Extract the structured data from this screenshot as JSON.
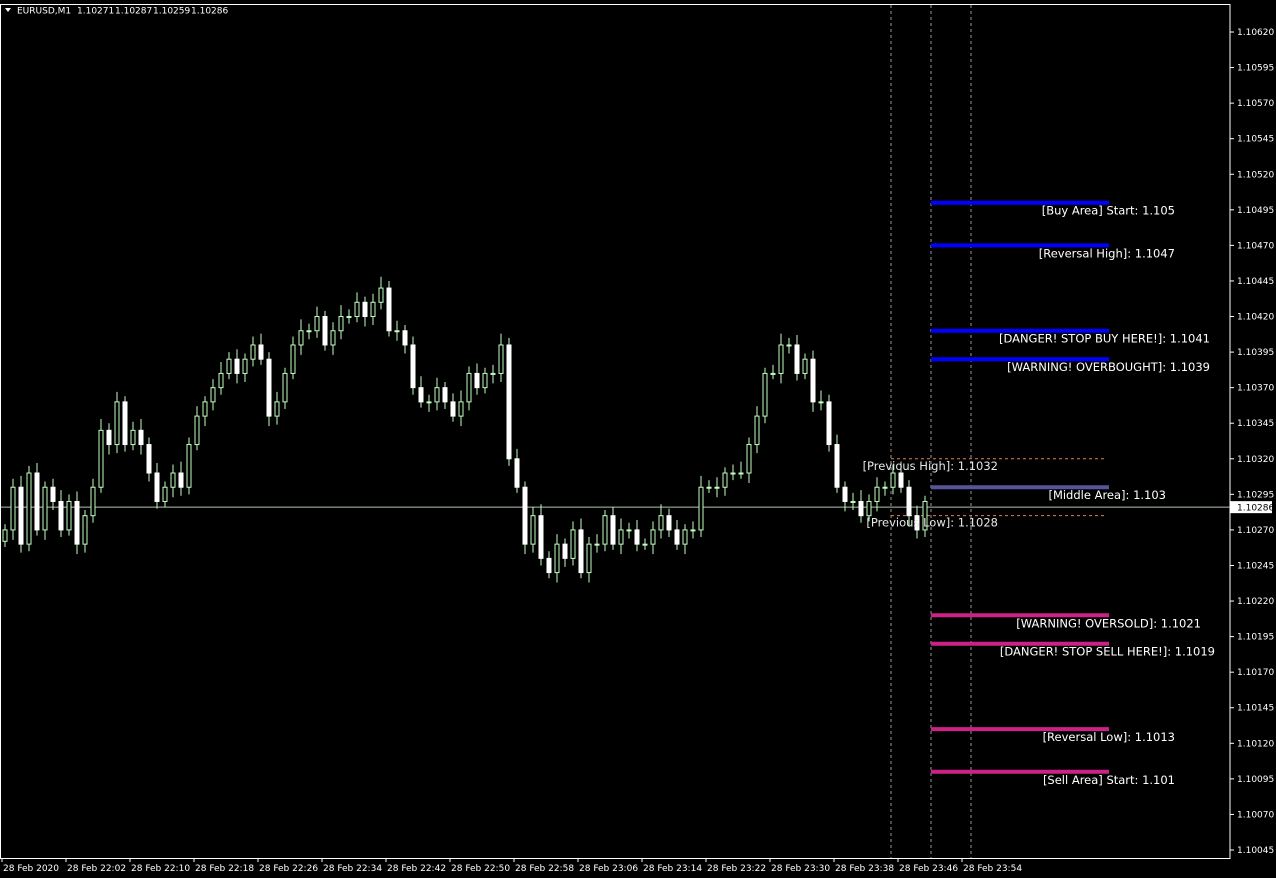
{
  "header": {
    "symbol_label": "EURUSD,M1",
    "open": "1.10271",
    "high": "1.10287",
    "low": "1.10259",
    "close": "1.10286"
  },
  "colors": {
    "background": "#000000",
    "frame": "#ffffff",
    "bull_body": "#000000",
    "bull_outline": "#bfffbf",
    "bear_body": "#ffffff",
    "wick": "#bfffbf",
    "buy_levels": "#0000ff",
    "sell_levels": "#cc2288",
    "middle_area": "#55559a",
    "bid_line": "#b0c4b0",
    "session_lines": "#ffffff",
    "prev_range": "#e08050"
  },
  "chart_data": {
    "type": "candlestick",
    "instrument": "EURUSD",
    "timeframe": "M1",
    "y_range": [
      1.1004,
      1.1063
    ],
    "y_ticks": [
      "1.10620",
      "1.10595",
      "1.10570",
      "1.10545",
      "1.10520",
      "1.10495",
      "1.10470",
      "1.10445",
      "1.10420",
      "1.10395",
      "1.10370",
      "1.10345",
      "1.10320",
      "1.10295",
      "1.10270",
      "1.10245",
      "1.10220",
      "1.10195",
      "1.10170",
      "1.10145",
      "1.10120",
      "1.10095",
      "1.10070",
      "1.10045"
    ],
    "x_ticks": [
      "28 Feb 2020",
      "28 Feb 22:02",
      "28 Feb 22:10",
      "28 Feb 22:18",
      "28 Feb 22:26",
      "28 Feb 22:34",
      "28 Feb 22:42",
      "28 Feb 22:50",
      "28 Feb 22:58",
      "28 Feb 23:06",
      "28 Feb 23:14",
      "28 Feb 23:22",
      "28 Feb 23:30",
      "28 Feb 23:38",
      "28 Feb 23:46",
      "28 Feb 23:54"
    ],
    "current_price": "1.10286",
    "closes": [
      1.1027,
      1.103,
      1.1026,
      1.1031,
      1.1027,
      1.103,
      1.1029,
      1.1027,
      1.1029,
      1.1026,
      1.1028,
      1.103,
      1.1034,
      1.1033,
      1.1036,
      1.1033,
      1.1034,
      1.1033,
      1.1031,
      1.1029,
      1.103,
      1.1031,
      1.103,
      1.1033,
      1.1035,
      1.1036,
      1.1037,
      1.1038,
      1.1039,
      1.1038,
      1.1039,
      1.104,
      1.1039,
      1.1035,
      1.1036,
      1.1038,
      1.104,
      1.1041,
      1.1041,
      1.1042,
      1.104,
      1.1041,
      1.1042,
      1.1042,
      1.1043,
      1.1042,
      1.1043,
      1.1044,
      1.1041,
      1.1041,
      1.104,
      1.1037,
      1.1036,
      1.1036,
      1.1037,
      1.1036,
      1.1035,
      1.1036,
      1.1038,
      1.1037,
      1.1038,
      1.1038,
      1.104,
      1.1032,
      1.103,
      1.1026,
      1.1028,
      1.1025,
      1.1024,
      1.1026,
      1.1025,
      1.1027,
      1.1024,
      1.1026,
      1.1026,
      1.1028,
      1.1026,
      1.1027,
      1.1027,
      1.1026,
      1.1026,
      1.1027,
      1.1028,
      1.1027,
      1.1026,
      1.1027,
      1.1027,
      1.103,
      1.103,
      1.103,
      1.1031,
      1.1031,
      1.1031,
      1.1033,
      1.1035,
      1.1038,
      1.1038,
      1.104,
      1.104,
      1.1038,
      1.1039,
      1.1036,
      1.1036,
      1.1033,
      1.103,
      1.1029,
      1.1029,
      1.1028,
      1.1029,
      1.103,
      1.103,
      1.1031,
      1.103,
      1.1028,
      1.1027,
      1.1029
    ],
    "levels": [
      {
        "label": "[Buy Area] Start: 1.105",
        "value": 1.105,
        "group": "buy"
      },
      {
        "label": "[Reversal High]: 1.1047",
        "value": 1.1047,
        "group": "buy"
      },
      {
        "label": "[DANGER! STOP BUY HERE!]: 1.1041",
        "value": 1.1041,
        "group": "buy"
      },
      {
        "label": "[WARNING! OVERBOUGHT]: 1.1039",
        "value": 1.1039,
        "group": "buy"
      },
      {
        "label": "[Middle Area]: 1.103",
        "value": 1.103,
        "group": "middle"
      },
      {
        "label": "[WARNING! OVERSOLD]: 1.1021",
        "value": 1.1021,
        "group": "sell"
      },
      {
        "label": "[DANGER! STOP SELL HERE!]: 1.1019",
        "value": 1.1019,
        "group": "sell"
      },
      {
        "label": "[Reversal Low]: 1.1013",
        "value": 1.1013,
        "group": "sell"
      },
      {
        "label": "[Sell Area] Start: 1.101",
        "value": 1.101,
        "group": "sell"
      }
    ],
    "previous_range": [
      {
        "label": "[Previous High]: 1.1032",
        "value": 1.1032
      },
      {
        "label": "[Previous Low]: 1.1028",
        "value": 1.1028
      }
    ],
    "grid": false
  }
}
